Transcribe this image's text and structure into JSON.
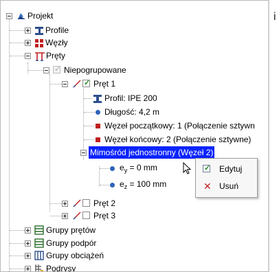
{
  "tree": {
    "root": {
      "label": "Projekt",
      "icon": "project-icon"
    },
    "profiles": {
      "label": "Profile",
      "icon": "profile-icon"
    },
    "nodes": {
      "label": "Węzły",
      "icon": "nodes-icon"
    },
    "bars": {
      "label": "Pręty",
      "icon": "bars-icon"
    },
    "ungrouped": {
      "label": "Niepogrupowane"
    },
    "bar1": {
      "label": "Pręt 1",
      "profile": "Profil: IPE 200",
      "length": "Długość: 4,2 m",
      "start_node": "Węzeł początkowy: 1 (Połączenie sztywn",
      "end_node": "Węzeł końcowy: 2 (Połączenie sztywne)",
      "eccentricity": "Mimośród jednostronny (Węzeł 2)",
      "ey": {
        "prefix": "e",
        "sub": "y",
        "value": " = 0 mm"
      },
      "ez": {
        "prefix": "e",
        "sub": "z",
        "value": " = 100 mm"
      }
    },
    "bar2": {
      "label": "Pręt 2"
    },
    "bar3": {
      "label": "Pręt 3"
    },
    "bar_groups": {
      "label": "Grupy prętów"
    },
    "support_groups": {
      "label": "Grupy podpór"
    },
    "load_groups": {
      "label": "Grupy obciążeń"
    },
    "underlays": {
      "label": "Podrysy"
    }
  },
  "context_menu": {
    "edit": "Edytuj",
    "delete": "Usuń"
  },
  "side_glyph": "i",
  "colors": {
    "selection": "#0a24ff",
    "dot_blue": "#2c63b8",
    "node_red": "#c21e1e",
    "check_green": "#2a8a2a"
  }
}
